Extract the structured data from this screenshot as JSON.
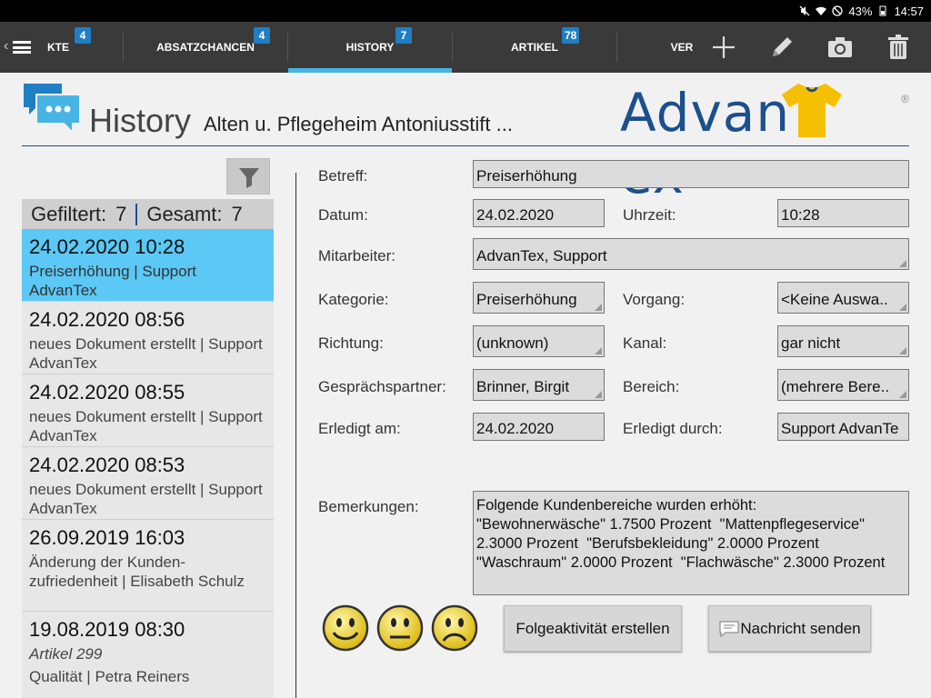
{
  "status": {
    "battery": "43%",
    "time": "14:57"
  },
  "tabs": [
    {
      "label": "KTE",
      "badge": "4"
    },
    {
      "label": "ABSATZCHANCEN",
      "badge": "4"
    },
    {
      "label": "HISTORY",
      "badge": "7"
    },
    {
      "label": "ARTIKEL",
      "badge": "78"
    },
    {
      "label": "VER",
      "badge": ""
    }
  ],
  "header": {
    "title": "History",
    "subtitle": "Alten u. Pflegeheim Antoniusstift ...",
    "logo_text": "AdvanTex",
    "logo_reg": "®"
  },
  "summary": {
    "filtered_label": "Gefiltert:",
    "filtered_count": "7",
    "total_label": "Gesamt:",
    "total_count": "7"
  },
  "history": [
    {
      "datetime": "24.02.2020 10:28",
      "desc": "Preiserhöhung | Support AdvanTex"
    },
    {
      "datetime": "24.02.2020 08:56",
      "desc": "neues Dokument erstellt | Support AdvanTex"
    },
    {
      "datetime": "24.02.2020 08:55",
      "desc": "neues Dokument erstellt | Support AdvanTex"
    },
    {
      "datetime": "24.02.2020 08:53",
      "desc": "neues Dokument erstellt | Support AdvanTex"
    },
    {
      "datetime": "26.09.2019 16:03",
      "desc": "Änderung der Kunden-zufriedenheit | Elisabeth Schulz"
    },
    {
      "datetime": "19.08.2019 08:30",
      "desc_italic": "Artikel 299",
      "desc": "Qualität | Petra Reiners"
    }
  ],
  "form": {
    "betreff_label": "Betreff:",
    "betreff": "Preiserhöhung",
    "datum_label": "Datum:",
    "datum": "24.02.2020",
    "uhrzeit_label": "Uhrzeit:",
    "uhrzeit": "10:28",
    "mitarbeiter_label": "Mitarbeiter:",
    "mitarbeiter": "AdvanTex, Support",
    "kategorie_label": "Kategorie:",
    "kategorie": "Preiserhöhung",
    "vorgang_label": "Vorgang:",
    "vorgang": "<Keine Auswa..",
    "richtung_label": "Richtung:",
    "richtung": "(unknown)",
    "kanal_label": "Kanal:",
    "kanal": "gar nicht",
    "partner_label": "Gesprächspartner:",
    "partner": "Brinner, Birgit",
    "bereich_label": "Bereich:",
    "bereich": "(mehrere Bere..",
    "erledigt_am_label": "Erledigt am:",
    "erledigt_am": "24.02.2020",
    "erledigt_durch_label": "Erledigt durch:",
    "erledigt_durch": "Support AdvanTe",
    "bemerkungen_label": "Bemerkungen:",
    "bemerkungen": "Folgende Kundenbereiche wurden erhöht:\n\"Bewohnerwäsche\" 1.7500 Prozent  \"Mattenpflegeservice\" 2.3000 Prozent  \"Berufsbekleidung\" 2.0000 Prozent \"Waschraum\" 2.0000 Prozent  \"Flachwäsche\" 2.3000 Prozent"
  },
  "buttons": {
    "followup": "Folgeaktivität erstellen",
    "message": "Nachricht senden"
  },
  "colors": {
    "accent": "#47b4e6",
    "selected": "#5bc8f5",
    "badge": "#1f7fc4",
    "brand": "#1b4f8e",
    "logo_shirt": "#f5c000"
  }
}
